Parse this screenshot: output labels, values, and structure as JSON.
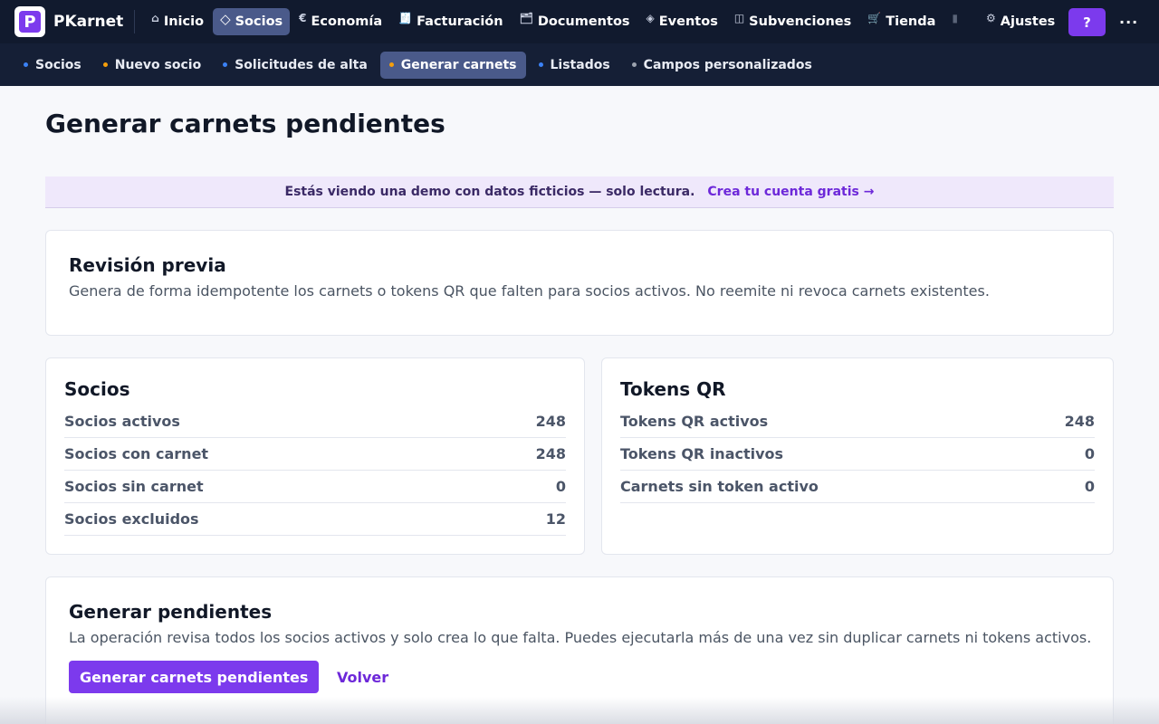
{
  "app": {
    "name": "PKarnet",
    "logo_letter": "P"
  },
  "topnav": [
    {
      "label": "Inicio",
      "icon": "⌂",
      "icon_name": "home-icon"
    },
    {
      "label": "Socios",
      "icon": "◇",
      "icon_name": "diamond-icon",
      "active": true
    },
    {
      "label": "Economía",
      "icon": "€",
      "icon_name": "euro-icon"
    },
    {
      "label": "Facturación",
      "icon": "🧾",
      "icon_name": "receipt-icon"
    },
    {
      "label": "Documentos",
      "icon": "🗂",
      "icon_name": "folder-icon"
    },
    {
      "label": "Eventos",
      "icon": "◈",
      "icon_name": "events-icon"
    },
    {
      "label": "Subvenciones",
      "icon": "◫",
      "icon_name": "grants-icon"
    },
    {
      "label": "Tienda",
      "icon": "🛒",
      "icon_name": "cart-icon"
    },
    {
      "label": "",
      "icon": "▮",
      "icon_name": "overflow-icon"
    },
    {
      "label": "Ajustes",
      "icon": "⚙",
      "icon_name": "gear-icon"
    }
  ],
  "help_label": "?",
  "more_label": "...",
  "subnav": [
    {
      "label": "Socios",
      "dot": "#3b82f6"
    },
    {
      "label": "Nuevo socio",
      "dot": "#f59e0b"
    },
    {
      "label": "Solicitudes de alta",
      "dot": "#3b82f6"
    },
    {
      "label": "Generar carnets",
      "dot": "#f59e0b",
      "active": true
    },
    {
      "label": "Listados",
      "dot": "#3b82f6"
    },
    {
      "label": "Campos personalizados",
      "dot": "#9ca3af"
    }
  ],
  "page": {
    "title": "Generar carnets pendientes"
  },
  "demo": {
    "text": "Estás viendo una demo con datos ficticios — solo lectura.",
    "link": "Crea tu cuenta gratis →"
  },
  "review": {
    "title": "Revisión previa",
    "desc": "Genera de forma idempotente los carnets o tokens QR que falten para socios activos. No reemite ni revoca carnets existentes."
  },
  "socios_card": {
    "title": "Socios",
    "rows": [
      {
        "label": "Socios activos",
        "value": "248"
      },
      {
        "label": "Socios con carnet",
        "value": "248"
      },
      {
        "label": "Socios sin carnet",
        "value": "0"
      },
      {
        "label": "Socios excluidos",
        "value": "12"
      }
    ]
  },
  "tokens_card": {
    "title": "Tokens QR",
    "rows": [
      {
        "label": "Tokens QR activos",
        "value": "248"
      },
      {
        "label": "Tokens QR inactivos",
        "value": "0"
      },
      {
        "label": "Carnets sin token activo",
        "value": "0"
      }
    ]
  },
  "generate": {
    "title": "Generar pendientes",
    "desc": "La operación revisa todos los socios activos y solo crea lo que falta. Puedes ejecutarla más de una vez sin duplicar carnets ni tokens activos.",
    "primary": "Generar carnets pendientes",
    "secondary": "Volver"
  },
  "colors": {
    "accent": "#7c3aed",
    "nav_bg": "#111a2e",
    "subnav_bg": "#151f36",
    "active_tab": "#4a5a8a"
  }
}
